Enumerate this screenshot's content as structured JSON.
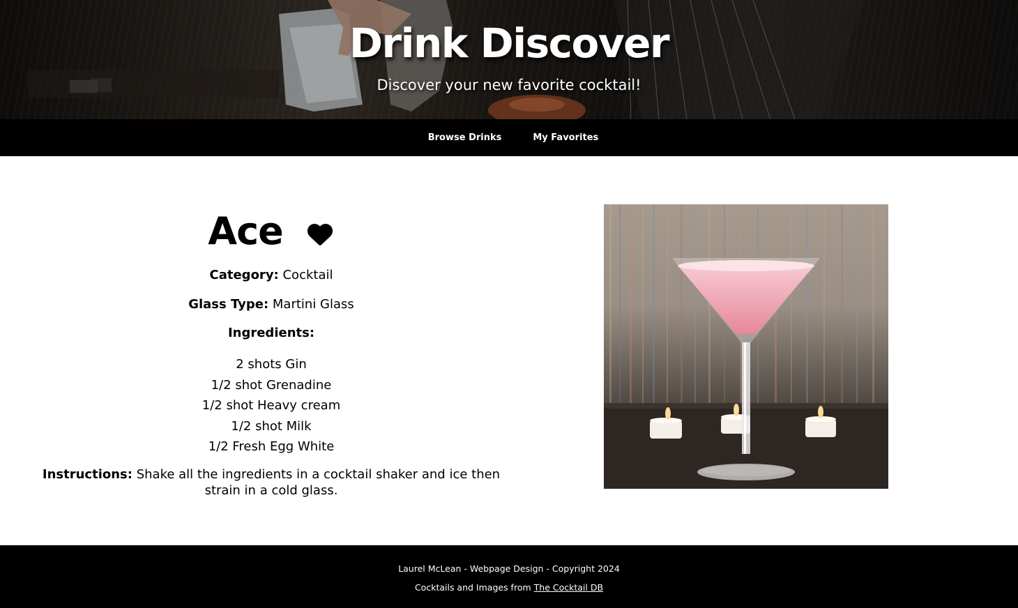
{
  "hero": {
    "title": "Drink Discover",
    "subtitle": "Discover your new favorite cocktail!"
  },
  "nav": {
    "items": [
      {
        "label": "Browse Drinks"
      },
      {
        "label": "My Favorites"
      }
    ]
  },
  "drink": {
    "name": "Ace",
    "favorite_icon": "heart-icon",
    "category_label": "Category:",
    "category": "Cocktail",
    "glass_label": "Glass Type:",
    "glass": "Martini Glass",
    "ingredients_label": "Ingredients:",
    "ingredients": [
      "2 shots Gin",
      "1/2 shot Grenadine",
      "1/2 shot Heavy cream",
      "1/2 shot Milk",
      "1/2 Fresh Egg White"
    ],
    "instructions_label": "Instructions:",
    "instructions": "Shake all the ingredients in a cocktail shaker and ice then strain in a cold glass."
  },
  "footer": {
    "credit": "Laurel McLean - Webpage Design - Copyright 2024",
    "source_prefix": "Cocktails and Images from",
    "source_link": "The Cocktail DB"
  },
  "colors": {
    "nav_bg": "#000000",
    "footer_bg": "#000000",
    "page_bg": "#ffffff",
    "text": "#000000"
  }
}
